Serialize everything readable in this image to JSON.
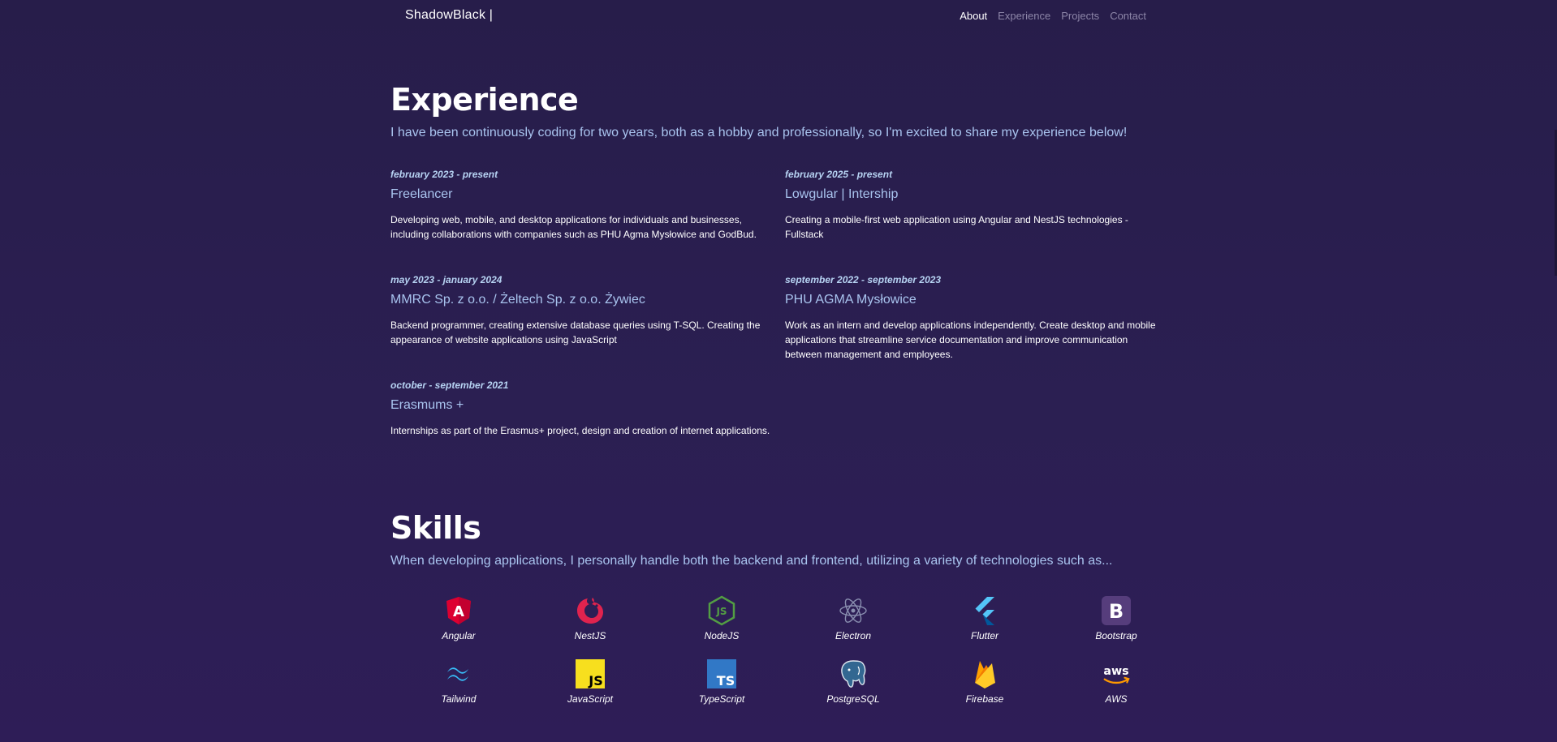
{
  "nav": {
    "brand": "ShadowBlack |",
    "links": [
      "About",
      "Experience",
      "Projects",
      "Contact"
    ]
  },
  "experience": {
    "title": "Experience",
    "lead": "I have been continuously coding for two years, both as a hobby and professionally, so I'm excited to share my experience below!",
    "left": [
      {
        "date": "february 2023 - present",
        "role": "Freelancer",
        "desc": "Developing web, mobile, and desktop applications for individuals and businesses, including collaborations with companies such as PHU Agma Mysłowice and GodBud."
      },
      {
        "date": "may 2023 - january 2024",
        "role": "MMRC Sp. z o.o. / Żeltech Sp. z o.o. Żywiec",
        "desc": "Backend programmer, creating extensive database queries using T-SQL. Creating the appearance of website applications using JavaScript"
      },
      {
        "date": "october - september 2021",
        "role": "Erasmums +",
        "desc": "Internships as part of the Erasmus+ project, design and creation of internet applications."
      }
    ],
    "right": [
      {
        "date": "february 2025 - present",
        "role": "Lowgular | Intership",
        "desc": "Creating a mobile-first web application using Angular and NestJS technologies - Fullstack"
      },
      {
        "date": "september 2022 - september 2023",
        "role": "PHU AGMA Mysłowice",
        "desc": "Work as an intern and develop applications independently. Create desktop and mobile applications that streamline service documentation and improve communication between management and employees."
      }
    ]
  },
  "skills": {
    "title": "Skills",
    "lead": "When developing applications, I personally handle both the backend and frontend, utilizing a variety of technologies such as...",
    "items": [
      {
        "label": "Angular",
        "icon": "angular-icon"
      },
      {
        "label": "NestJS",
        "icon": "nestjs-icon"
      },
      {
        "label": "NodeJS",
        "icon": "nodejs-icon"
      },
      {
        "label": "Electron",
        "icon": "electron-icon"
      },
      {
        "label": "Flutter",
        "icon": "flutter-icon"
      },
      {
        "label": "Bootstrap",
        "icon": "bootstrap-icon"
      },
      {
        "label": "Tailwind",
        "icon": "tailwind-icon"
      },
      {
        "label": "JavaScript",
        "icon": "javascript-icon"
      },
      {
        "label": "TypeScript",
        "icon": "typescript-icon"
      },
      {
        "label": "PostgreSQL",
        "icon": "postgresql-icon"
      },
      {
        "label": "Firebase",
        "icon": "firebase-icon"
      },
      {
        "label": "AWS",
        "icon": "aws-icon"
      }
    ],
    "icon_text": {
      "angular": "A",
      "nodejs": "JS",
      "bootstrap": "B",
      "javascript": "JS",
      "typescript": "TS",
      "aws": "aws"
    }
  },
  "colors": {
    "background": "#2a1e50",
    "accent": "#a9c4ef",
    "date": "#b7d3f3",
    "nav_inactive": "#8d86a8"
  }
}
